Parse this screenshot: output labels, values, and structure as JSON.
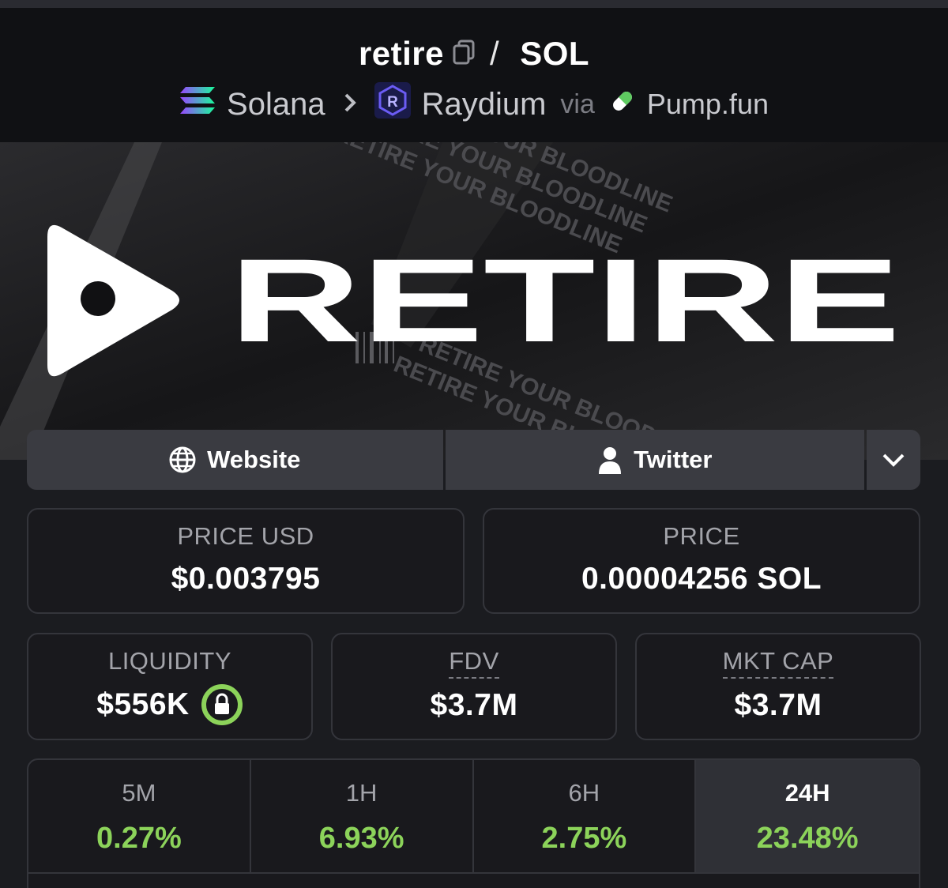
{
  "pair": {
    "token": "retire",
    "separator": "/",
    "quote": "SOL"
  },
  "breadcrumb": {
    "chain": "Solana",
    "dex": "Raydium",
    "via_label": "via",
    "launchpad": "Pump.fun"
  },
  "banner": {
    "logo_text": "RETIRE",
    "tagline": "RETIRE YOUR BLOODLINE"
  },
  "links": {
    "website": "Website",
    "twitter": "Twitter"
  },
  "stats": {
    "price_usd": {
      "label": "PRICE USD",
      "value": "$0.003795"
    },
    "price_native": {
      "label": "PRICE",
      "value": "0.00004256 SOL"
    },
    "liquidity": {
      "label": "LIQUIDITY",
      "value": "$556K"
    },
    "fdv": {
      "label": "FDV",
      "value": "$3.7M"
    },
    "mkt_cap": {
      "label": "MKT CAP",
      "value": "$3.7M"
    }
  },
  "changes": [
    {
      "period": "5M",
      "value": "0.27%"
    },
    {
      "period": "1H",
      "value": "6.93%"
    },
    {
      "period": "6H",
      "value": "2.75%"
    },
    {
      "period": "24H",
      "value": "23.48%",
      "selected": true
    }
  ],
  "colors": {
    "positive": "#8cd35a",
    "lock_ring": "#8cd35a",
    "background": "#1b1c20"
  },
  "icons": [
    "copy-icon",
    "solana-icon",
    "chevron-right-icon",
    "raydium-icon",
    "pill-icon",
    "globe-icon",
    "user-icon",
    "chevron-down-icon",
    "lock-icon"
  ]
}
